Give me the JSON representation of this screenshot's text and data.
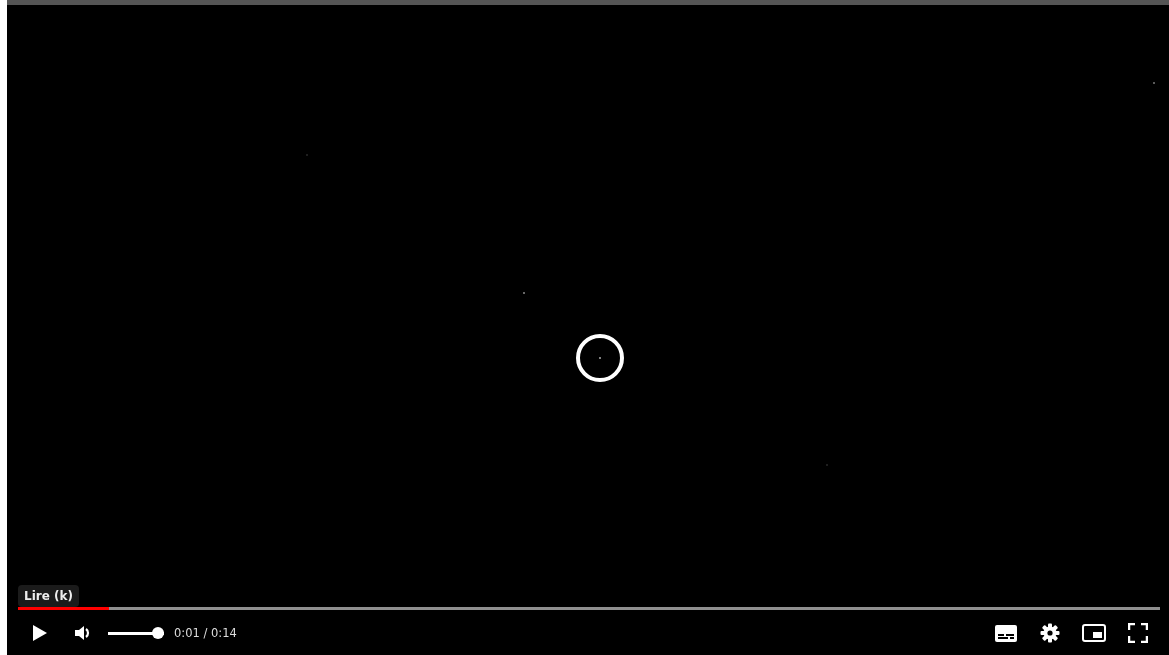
{
  "tooltip": "Lire (k)",
  "progress": {
    "level": 0.08
  },
  "volume": {
    "level": 1
  },
  "time": "0:01 / 0:14"
}
